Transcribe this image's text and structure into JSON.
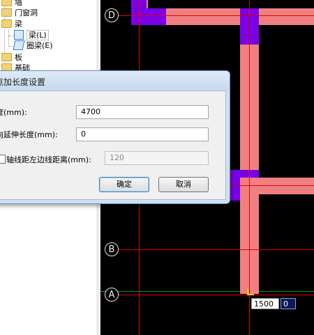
{
  "tree": {
    "items": [
      {
        "label": "墙",
        "icon": "folder-icon"
      },
      {
        "label": "门窗洞",
        "icon": "folder-icon"
      },
      {
        "label": "梁",
        "icon": "folder-icon"
      },
      {
        "label": "梁(L)",
        "icon": "beam-icon"
      },
      {
        "label": "圈梁(E)",
        "icon": "ring-beam-icon"
      },
      {
        "label": "板",
        "icon": "folder-icon"
      },
      {
        "label": "基础",
        "icon": "folder-icon"
      }
    ]
  },
  "dialog": {
    "title": "点加长度设置",
    "length_label": "长度(mm):",
    "length_value": "4700",
    "reverse_label": "反向延伸长度(mm):",
    "reverse_value": "0",
    "axis_offset_label": "轴线距左边线距离(mm):",
    "axis_offset_value": "120",
    "axis_offset_checked": false,
    "ok_label": "确定",
    "cancel_label": "取消"
  },
  "canvas": {
    "axes": [
      "D",
      "B",
      "A"
    ],
    "coord_input_1": "1500",
    "coord_input_2": "0",
    "colors": {
      "background": "#000000",
      "beam": "#f08080",
      "column": "#7a00e6",
      "axis_line": "#e00000",
      "grid_line": "#00a000"
    }
  }
}
